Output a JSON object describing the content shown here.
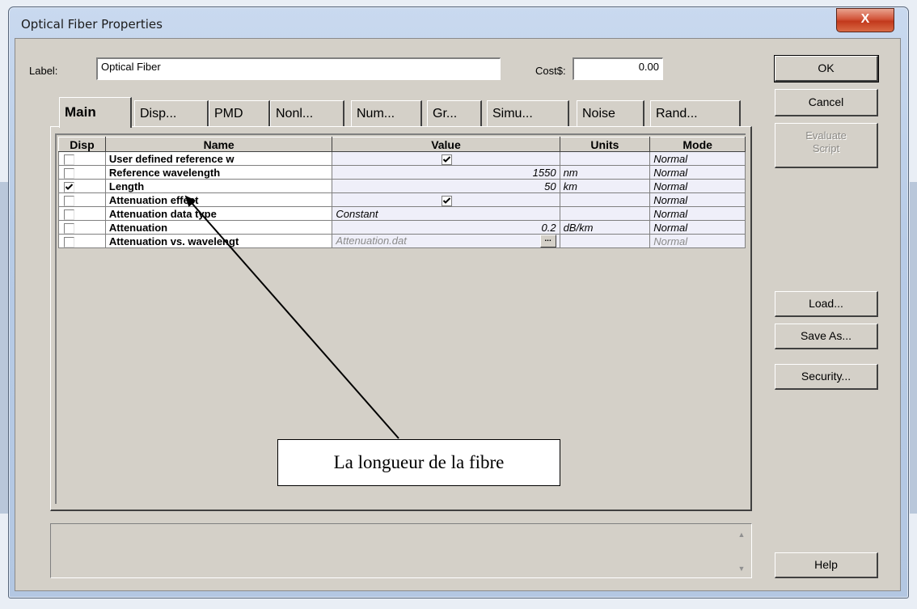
{
  "window": {
    "title": "Optical Fiber Properties",
    "close_glyph": "X"
  },
  "label_row": {
    "label_caption": "Label:",
    "label_value": "Optical Fiber",
    "cost_caption": "Cost$:",
    "cost_value": "0.00"
  },
  "tabs": [
    {
      "label": "Main",
      "active": true
    },
    {
      "label": "Disp...",
      "active": false
    },
    {
      "label": "PMD",
      "active": false
    },
    {
      "label": "Nonl...",
      "active": false
    },
    {
      "label": "Num...",
      "active": false
    },
    {
      "label": "Gr...",
      "active": false
    },
    {
      "label": "Simu...",
      "active": false
    },
    {
      "label": "Noise",
      "active": false
    },
    {
      "label": "Rand...",
      "active": false
    }
  ],
  "table": {
    "headers": {
      "disp": "Disp",
      "name": "Name",
      "value": "Value",
      "units": "Units",
      "mode": "Mode"
    },
    "rows": [
      {
        "disp": false,
        "name": "User defined reference w",
        "value": "",
        "value_checkbox": true,
        "units": "",
        "mode": "Normal"
      },
      {
        "disp": false,
        "name": "Reference wavelength",
        "value": "1550",
        "units": "nm",
        "mode": "Normal"
      },
      {
        "disp": true,
        "name": "Length",
        "value": "50",
        "units": "km",
        "mode": "Normal"
      },
      {
        "disp": false,
        "name": "Attenuation effect",
        "value": "",
        "value_checkbox": true,
        "units": "",
        "mode": "Normal"
      },
      {
        "disp": false,
        "name": "Attenuation data type",
        "value": "Constant",
        "units": "",
        "mode": "Normal"
      },
      {
        "disp": false,
        "name": "Attenuation",
        "value": "0.2",
        "units": "dB/km",
        "mode": "Normal"
      },
      {
        "disp": false,
        "name": "Attenuation vs. wavelengt",
        "value": "Attenuation.dat",
        "units": "",
        "mode": "Normal",
        "dim": true,
        "browse": "..."
      }
    ]
  },
  "annotation": {
    "text": "La longueur de la fibre"
  },
  "buttons": {
    "ok": "OK",
    "cancel": "Cancel",
    "evaluate_line1": "Evaluate",
    "evaluate_line2": "Script",
    "load": "Load...",
    "save_as": "Save As...",
    "security": "Security...",
    "help": "Help"
  }
}
